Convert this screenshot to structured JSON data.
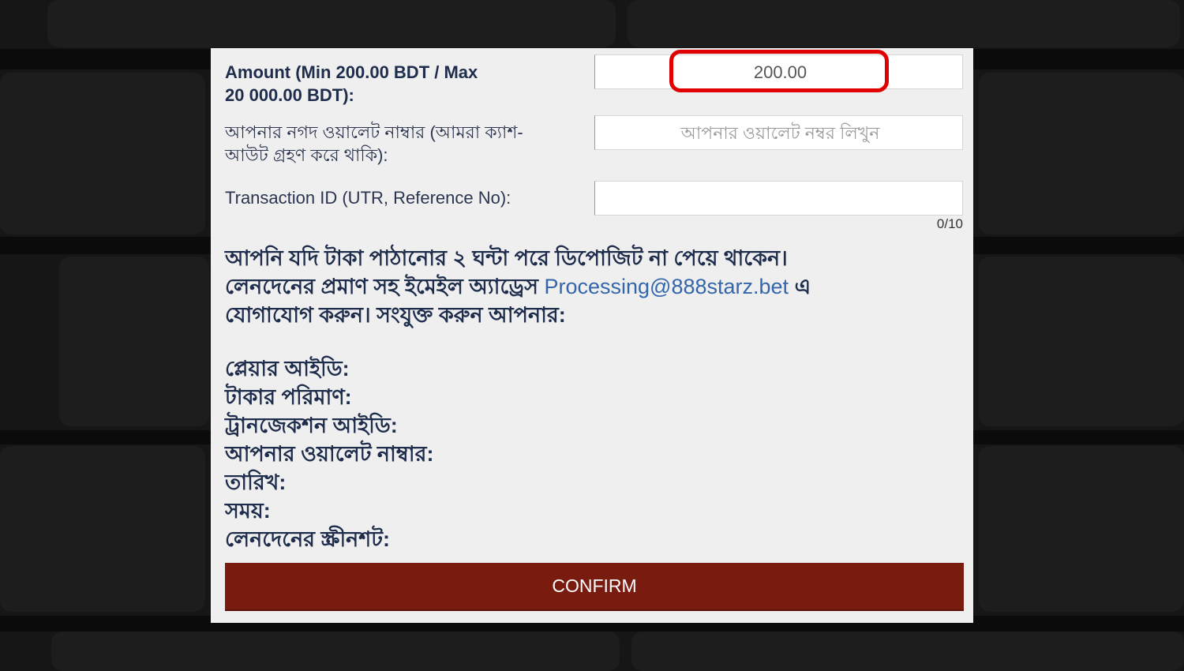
{
  "form": {
    "amount_label_line1": "Amount (Min 200.00 BDT / Max",
    "amount_label_line2": "20 000.00 BDT):",
    "amount_value": "200.00",
    "wallet_label_line1": "আপনার নগদ ওয়ালেট নাম্বার (আমরা ক্যাশ-",
    "wallet_label_line2": "আউট গ্রহণ করে থাকি):",
    "wallet_placeholder": "আপনার ওয়ালেট নম্বর লিখুন",
    "transaction_label": "Transaction ID (UTR, Reference No):",
    "transaction_value": "",
    "transaction_counter": "0/10"
  },
  "notice": {
    "line1": "আপনি যদি টাকা পাঠানোর ২ ঘন্টা পরে ডিপোজিট না পেয়ে থাকেন।",
    "line2_start": "লেনদেনের প্রমাণ সহ ইমেইল অ্যাড্রেস",
    "email": "Processing@888starz.bet",
    "line2_end": "এ",
    "line3": "যোগাযোগ করুন। সংযুক্ত করুন আপনার:"
  },
  "details": [
    "প্লেয়ার আইডি:",
    "টাকার পরিমাণ:",
    "ট্রানজেকশন আইডি:",
    "আপনার ওয়ালেট নাম্বার:",
    "তারিখ:",
    "সময়:",
    "লেনদেনের স্ক্রীনশট:"
  ],
  "confirm_label": "CONFIRM",
  "colors": {
    "confirm_bg": "#7a1b10",
    "highlight": "#e00000",
    "email_link": "#3366aa"
  }
}
